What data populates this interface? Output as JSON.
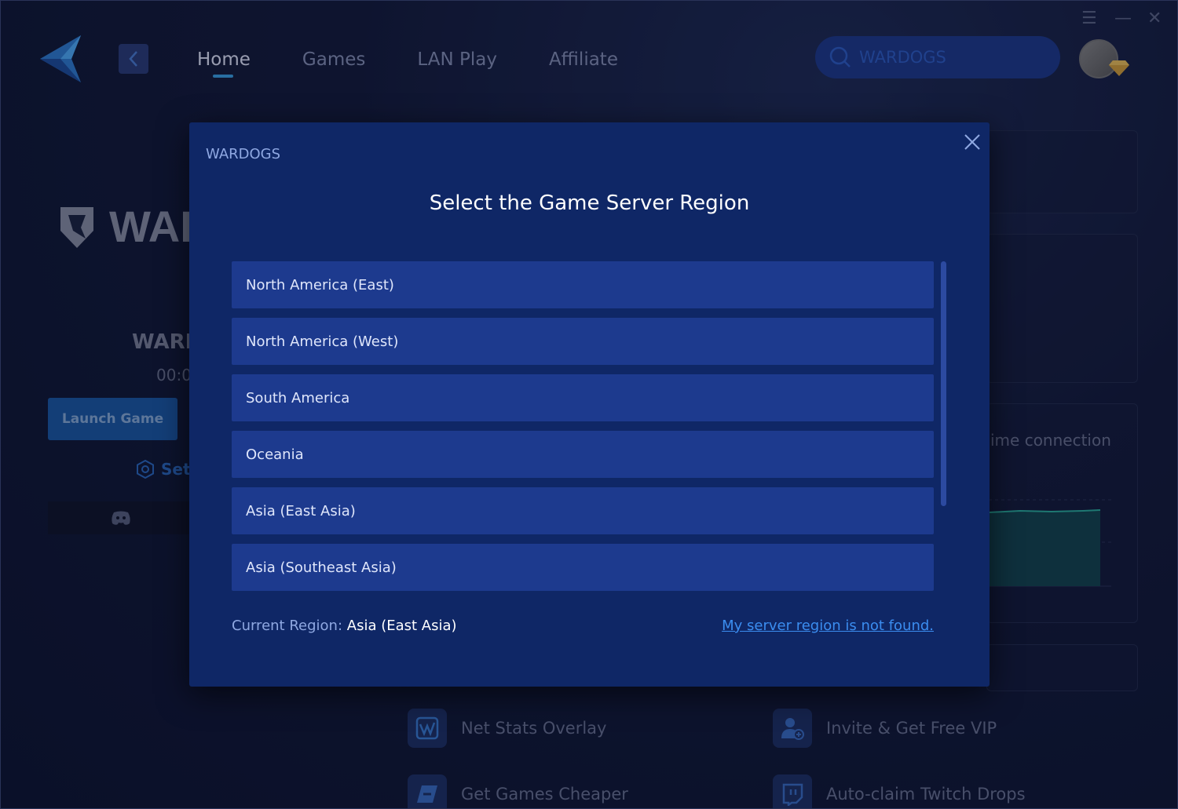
{
  "nav": {
    "items": [
      "Home",
      "Games",
      "LAN Play",
      "Affiliate"
    ],
    "active": "Home"
  },
  "search": {
    "value": "WARDOGS"
  },
  "window_controls": {
    "menu": "☰",
    "minimize": "—",
    "close": "✕"
  },
  "background": {
    "game_logo_text": "WAR",
    "game_name": "WARD",
    "timer": "00:0",
    "launch_label": "Launch Game",
    "settings_label": "Sett",
    "connection_text": "ime connection",
    "features": [
      {
        "label": "Net Stats Overlay",
        "icon": "chart-icon"
      },
      {
        "label": "Invite & Get Free VIP",
        "icon": "add-user-icon"
      },
      {
        "label": "Get Games Cheaper",
        "icon": "tag-icon"
      },
      {
        "label": "Auto-claim Twitch Drops",
        "icon": "twitch-icon"
      }
    ]
  },
  "modal": {
    "game": "WARDOGS",
    "title": "Select the Game Server Region",
    "regions": [
      "North America (East)",
      "North America (West)",
      "South America",
      "Oceania",
      "Asia (East Asia)",
      "Asia (Southeast Asia)"
    ],
    "current_label": "Current Region:",
    "current_value": "Asia (East Asia)",
    "not_found_link": "My server region is not found."
  },
  "colors": {
    "modal_bg": "#0f2766",
    "region_bg": "#1d3a8e",
    "accent": "#3aa3e8",
    "link": "#3b8df0"
  }
}
